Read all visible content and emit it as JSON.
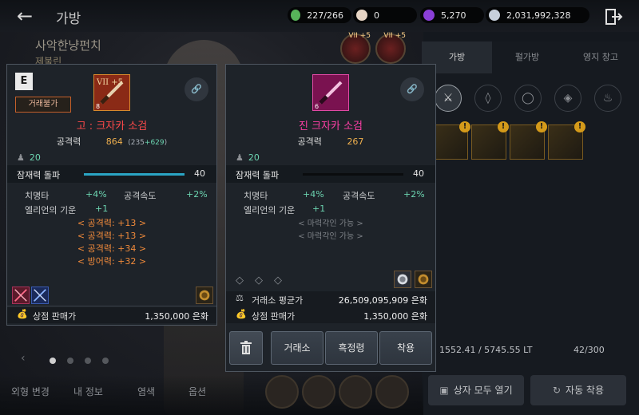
{
  "header": {
    "title": "가방",
    "currencies": [
      {
        "icon": "green-gem-icon",
        "color": "#57b45a",
        "value": "227/266"
      },
      {
        "icon": "pearl-icon",
        "color": "#e7d5c5",
        "value": "0"
      },
      {
        "icon": "purple-gem-icon",
        "color": "#8a3fd6",
        "value": "5,270"
      },
      {
        "icon": "silver-coin-icon",
        "color": "#c7d0dc",
        "value": "2,031,992,328"
      }
    ]
  },
  "background": {
    "character_name": "사악한냥펀치",
    "sub_label": "제불린",
    "equip_badges": [
      "VII +5",
      "VII +5"
    ]
  },
  "inventory": {
    "tabs": [
      "가방",
      "펄가방",
      "영지 창고"
    ],
    "active_tab": 0,
    "filters": [
      "crossed-swords-icon",
      "armor-icon",
      "ring-icon",
      "shield-icon",
      "potion-icon"
    ],
    "weight": "1552.41 / 5745.55 LT",
    "slots": "42/300",
    "open_all_label": "상자 모두 열기",
    "auto_equip_label": "자동 착용"
  },
  "bottom_bar": {
    "appearance_label": "외형 변경",
    "my_info_label": "내 정보",
    "dye_label": "염색",
    "options_label": "옵션"
  },
  "left_card": {
    "grade": "E",
    "trade_tag": "거래불가",
    "enhance_badge": "VII +5",
    "item_level": "8",
    "name": "고 : 크자카 소검",
    "name_color": "#ff4a4a",
    "attack_label": "공격력",
    "attack_value": "864",
    "attack_base": "(235",
    "attack_plus": "+629",
    "attack_close": ")",
    "required_level": "20",
    "potential_label": "잠재력 돌파",
    "potential_value": "40",
    "potential_fill": 1.0,
    "stats": [
      {
        "name": "치명타",
        "value": "+4%"
      },
      {
        "name": "공격속도",
        "value": "+2%"
      },
      {
        "name": "엘리언의 기운",
        "value": "+1"
      }
    ],
    "bonuses": [
      "< 공격력: +13 >",
      "< 공격력: +13 >",
      "< 공격력: +34 >",
      "< 방어력: +32 >"
    ],
    "shop_price_label": "상점 판매가",
    "shop_price_value": "1,350,000 은화"
  },
  "right_card": {
    "item_level": "6",
    "name": "진 크자카 소검",
    "name_color": "#ff3fa6",
    "attack_label": "공격력",
    "attack_value": "267",
    "required_level": "20",
    "potential_label": "잠재력 돌파",
    "potential_value": "40",
    "potential_fill": 0.0,
    "stats": [
      {
        "name": "치명타",
        "value": "+4%"
      },
      {
        "name": "공격속도",
        "value": "+2%"
      },
      {
        "name": "엘리언의 기운",
        "value": "+1"
      }
    ],
    "locked": [
      "< 마력각인 가능 >",
      "< 마력각인 가능 >"
    ],
    "market_avg_label": "거래소 평균가",
    "market_avg_value": "26,509,095,909 은화",
    "shop_price_label": "상점 판매가",
    "shop_price_value": "1,350,000 은화",
    "buttons": {
      "trash_icon": "trash-icon",
      "exchange": "거래소",
      "appraise": "흑정령",
      "equip": "착용"
    }
  }
}
